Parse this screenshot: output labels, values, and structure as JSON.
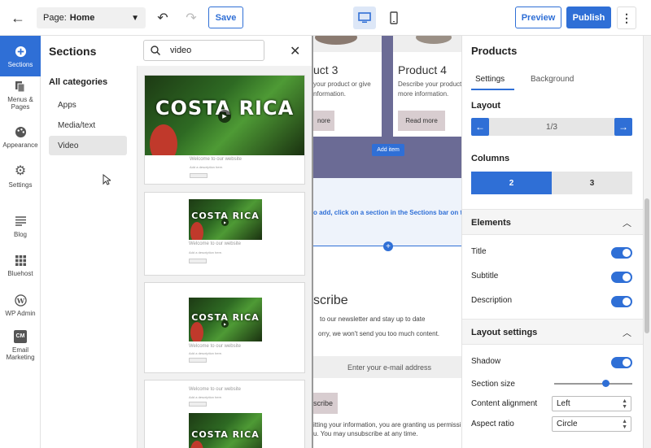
{
  "topbar": {
    "page_label": "Page:",
    "page_value": "Home",
    "save_label": "Save",
    "preview_label": "Preview",
    "publish_label": "Publish"
  },
  "leftnav": {
    "items": [
      {
        "label": "Sections",
        "icon": "plus-circle-icon"
      },
      {
        "label": "Menus & Pages",
        "icon": "pages-icon"
      },
      {
        "label": "Appearance",
        "icon": "palette-icon"
      },
      {
        "label": "Settings",
        "icon": "gear-icon"
      },
      {
        "label": "Blog",
        "icon": "blog-icon"
      },
      {
        "label": "Bluehost",
        "icon": "grid-icon"
      },
      {
        "label": "WP Admin",
        "icon": "wordpress-icon"
      },
      {
        "label": "Email Marketing",
        "icon": "cm-icon",
        "badge": "CM"
      }
    ]
  },
  "sections_panel": {
    "title": "Sections",
    "search_value": "video",
    "categories_title": "All categories",
    "categories": [
      "Apps",
      "Media/text",
      "Video"
    ],
    "active_category": "Video",
    "cards": [
      {
        "video_title": "COSTA RICA",
        "text": "Welcome to our website",
        "small": "Add a description here."
      },
      {
        "video_title": "COSTA RICA",
        "text": "Welcome to our website",
        "small": "Add a description here."
      },
      {
        "video_title": "COSTA RICA",
        "text": "Welcome to our website",
        "small": "Add a description here."
      },
      {
        "video_title": "COSTA RICA",
        "text": "Welcome to our website",
        "small": "Add a description here."
      }
    ]
  },
  "canvas": {
    "products": [
      {
        "title": "uct 3",
        "desc1": "your product or give",
        "desc2": "nformation.",
        "button": "nore"
      },
      {
        "title": "Product 4",
        "desc1": "Describe your product or give",
        "desc2": "more information.",
        "button": "Read more"
      }
    ],
    "add_item": "Add item",
    "drop_text": "o add, click on a section in the Sections bar on the le",
    "subscribe_title": "scribe",
    "subscribe_line1": "to our newsletter and stay up to date",
    "subscribe_line2": "orry, we won't send you too much content.",
    "email_placeholder": "Enter your e-mail address",
    "subscribe_button": "scribe",
    "legal1": "itting your information, you are granting us permissi",
    "legal2": "u. You may unsubscribe at any time."
  },
  "right_panel": {
    "title": "Products",
    "tabs": [
      "Settings",
      "Background"
    ],
    "layout_label": "Layout",
    "layout_value": "1/3",
    "columns_label": "Columns",
    "columns": [
      "2",
      "3"
    ],
    "columns_selected": "2",
    "elements_header": "Elements",
    "toggles": [
      {
        "label": "Title",
        "on": true
      },
      {
        "label": "Subtitle",
        "on": true
      },
      {
        "label": "Description",
        "on": true
      }
    ],
    "layout_settings_header": "Layout settings",
    "shadow_label": "Shadow",
    "shadow_on": true,
    "section_size_label": "Section size",
    "section_size_level": 0.66,
    "content_alignment_label": "Content alignment",
    "content_alignment_value": "Left",
    "aspect_ratio_label": "Aspect ratio",
    "aspect_ratio_value": "Circle"
  },
  "colors": {
    "accent": "#2f6fd6",
    "band": "#6b6b95",
    "drop_zone": "#eef3fb"
  }
}
